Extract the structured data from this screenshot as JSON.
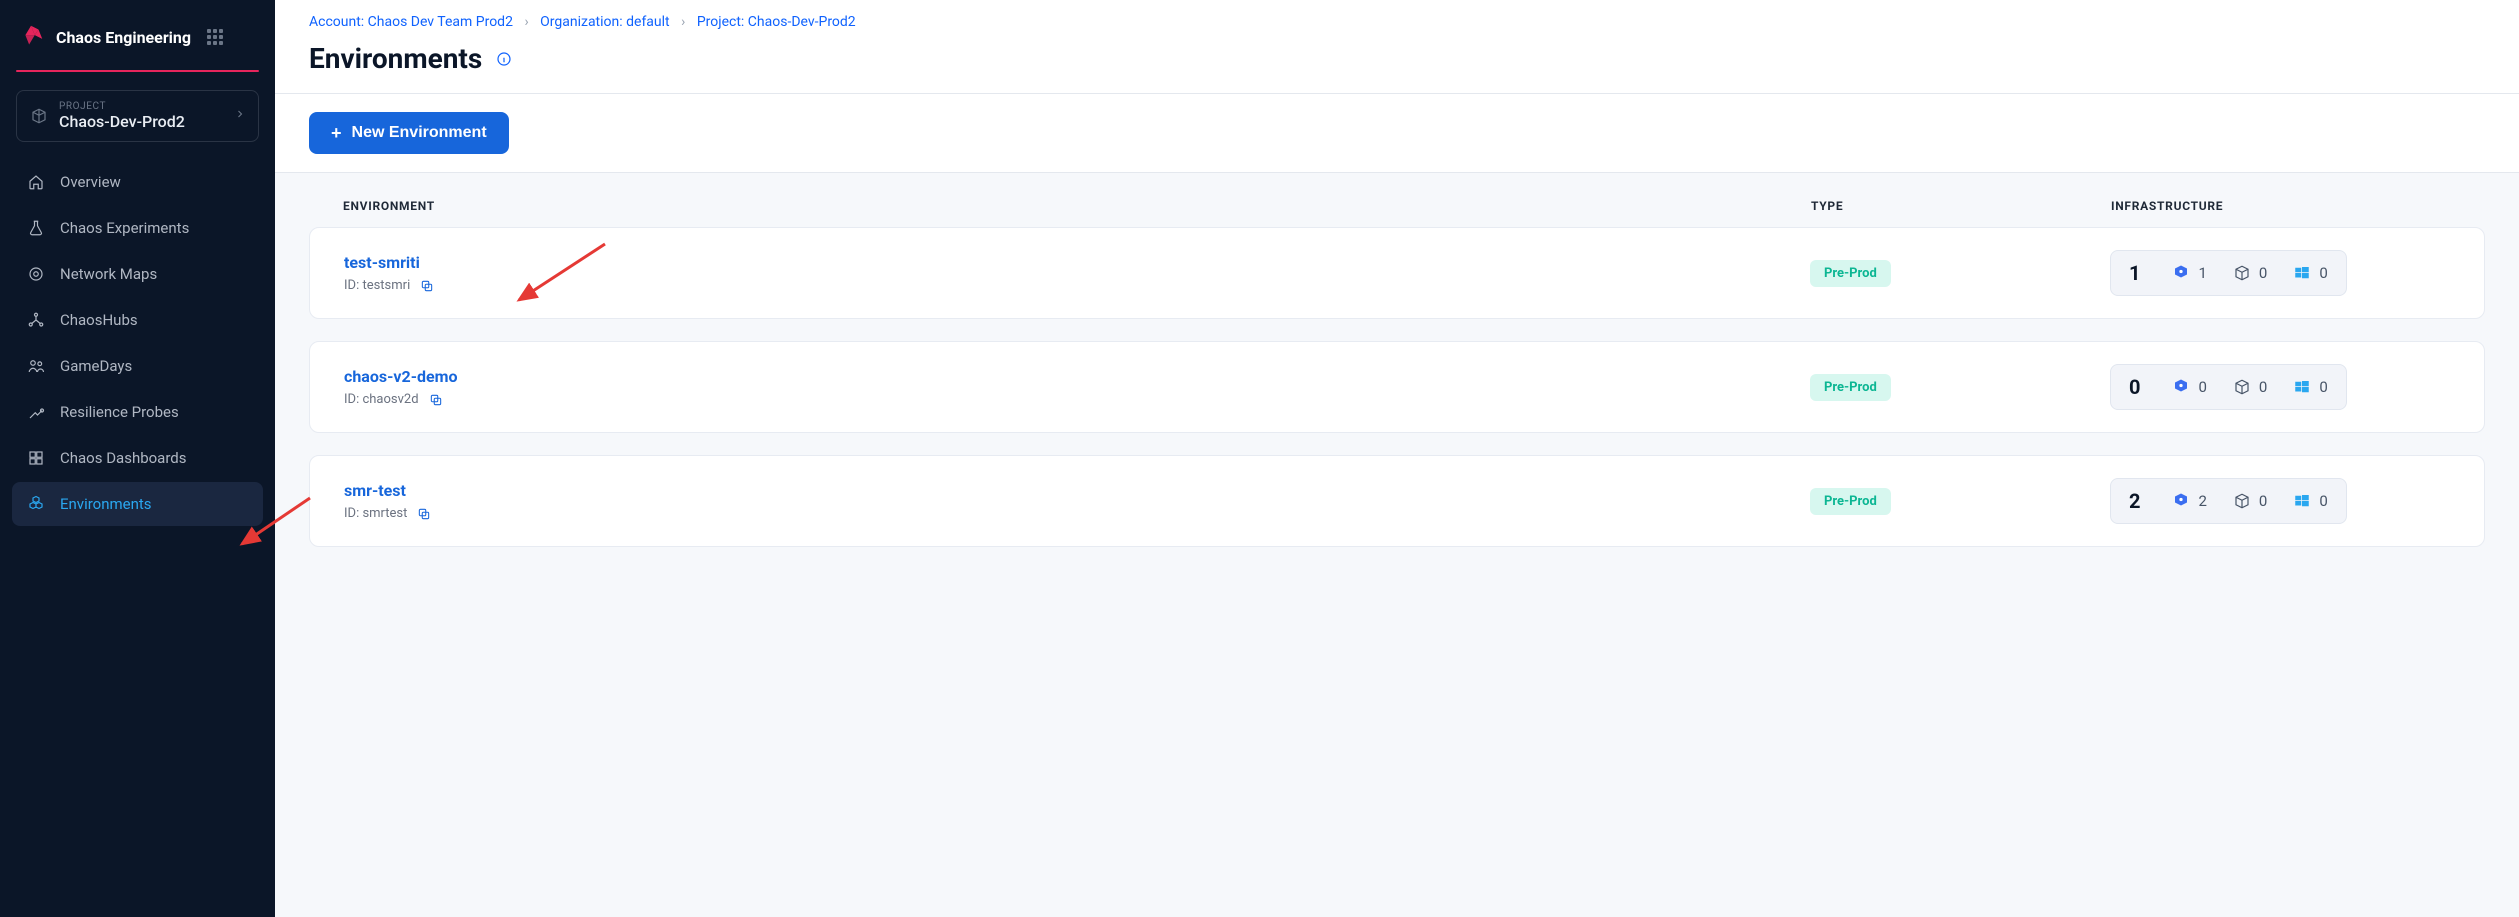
{
  "sidebar": {
    "brand": "Chaos Engineering",
    "project_label": "PROJECT",
    "project_name": "Chaos-Dev-Prod2",
    "items": [
      {
        "label": "Overview",
        "icon": "home",
        "active": false
      },
      {
        "label": "Chaos Experiments",
        "icon": "flask",
        "active": false
      },
      {
        "label": "Network Maps",
        "icon": "target",
        "active": false
      },
      {
        "label": "ChaosHubs",
        "icon": "nodes",
        "active": false
      },
      {
        "label": "GameDays",
        "icon": "people",
        "active": false
      },
      {
        "label": "Resilience Probes",
        "icon": "probe",
        "active": false
      },
      {
        "label": "Chaos Dashboards",
        "icon": "dashboard",
        "active": false
      },
      {
        "label": "Environments",
        "icon": "hex",
        "active": true
      }
    ]
  },
  "breadcrumbs": {
    "account": "Account: Chaos Dev Team Prod2",
    "organization": "Organization: default",
    "project": "Project: Chaos-Dev-Prod2"
  },
  "page": {
    "title": "Environments",
    "new_button": "New Environment"
  },
  "table": {
    "headers": {
      "env": "ENVIRONMENT",
      "type": "TYPE",
      "infra": "INFRASTRUCTURE"
    },
    "rows": [
      {
        "name": "test-smriti",
        "id_label": "ID: testsmri",
        "type": "Pre-Prod",
        "total": "1",
        "k8s": "1",
        "cube": "0",
        "win": "0"
      },
      {
        "name": "chaos-v2-demo",
        "id_label": "ID: chaosv2d",
        "type": "Pre-Prod",
        "total": "0",
        "k8s": "0",
        "cube": "0",
        "win": "0"
      },
      {
        "name": "smr-test",
        "id_label": "ID: smrtest",
        "type": "Pre-Prod",
        "total": "2",
        "k8s": "2",
        "cube": "0",
        "win": "0"
      }
    ]
  }
}
